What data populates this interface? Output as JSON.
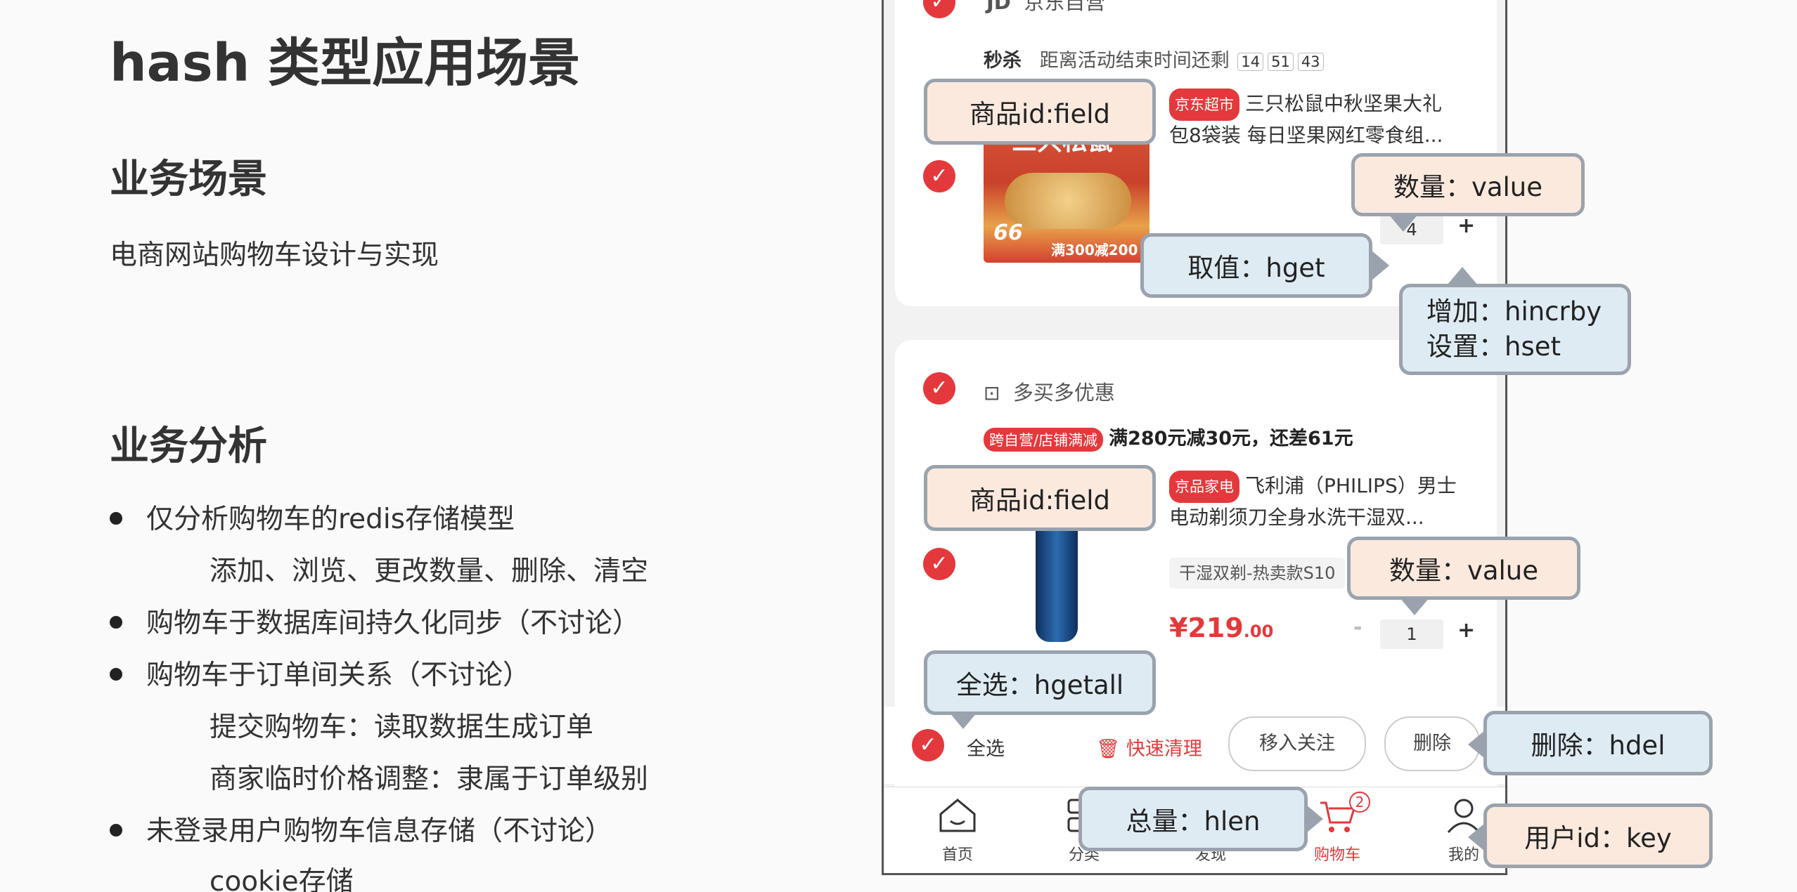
{
  "slide": {
    "title": "hash 类型应用场景",
    "section1_heading": "业务场景",
    "section1_text": "电商网站购物车设计与实现",
    "section2_heading": "业务分析",
    "bullets": [
      "仅分析购物车的redis存储模型",
      "购物车于数据库间持久化同步（不讨论）",
      "购物车于订单间关系（不讨论）",
      "未登录用户购物车信息存储（不讨论）"
    ],
    "subs": [
      "添加、浏览、更改数量、删除、清空",
      "提交购物车：读取数据生成订单",
      "商家临时价格调整：隶属于订单级别",
      "cookie存储"
    ]
  },
  "phone": {
    "store1": "京东自营",
    "store1_logo": "JD",
    "flash_label": "秒杀",
    "countdown_label": "距离活动结束时间还剩",
    "countdown": [
      "14",
      "51",
      "43"
    ],
    "item1_tag": "京东超市",
    "item1_title_line1": "三只松鼠中秋坚果大礼",
    "item1_title_line2": "包8袋装 每日坚果网红零食组...",
    "item1_img_text": "三只松鼠",
    "item1_badge": "66",
    "item1_promo": "满300减200",
    "item1_qty": "4",
    "store2": "多买多优惠",
    "promo_tag": "跨自营/店铺满减",
    "promo_text": "满280元减30元，还差61元",
    "item2_tag": "京品家电",
    "item2_title_line1": "飞利浦（PHILIPS）男士",
    "item2_title_line2": "电动剃须刀全身水洗干湿双...",
    "item2_variant": "干湿双剃-热卖款S10",
    "item2_price": "¥219",
    "item2_price_dec": ".00",
    "item2_qty": "1",
    "minus": "-",
    "plus": "+",
    "select_all": "全选",
    "quick_clean": "快速清理",
    "move_follow": "移入关注",
    "delete": "删除",
    "cart_badge": "2",
    "nav": [
      "首页",
      "分类",
      "发现",
      "购物车",
      "我的"
    ]
  },
  "callouts": {
    "field1": "商品id:field",
    "value1": "数量：value",
    "hget": "取值：hget",
    "incr": "增加：hincrby",
    "hset": "设置：hset",
    "field2": "商品id:field",
    "value2": "数量：value",
    "hgetall": "全选：hgetall",
    "hdel": "删除：hdel",
    "hlen": "总量：hlen",
    "key": "用户id：key"
  },
  "colors": {
    "accent": "#e4393c",
    "callout_peach": "#fbe9de",
    "callout_blue": "#deebf3",
    "callout_border": "#9aa3ad"
  }
}
